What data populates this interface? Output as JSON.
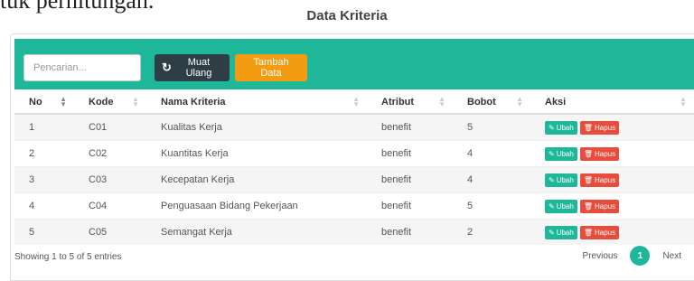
{
  "top_text": "tuk perhitungan.",
  "title": "Data Kriteria",
  "search": {
    "placeholder": "Pencarian..."
  },
  "buttons": {
    "reload": "Muat Ulang",
    "add": "Tambah Data"
  },
  "table": {
    "headers": [
      "No",
      "Kode",
      "Nama Kriteria",
      "Atribut",
      "Bobot",
      "Aksi"
    ],
    "rows": [
      [
        "1",
        "C01",
        "Kualitas Kerja",
        "benefit",
        "5"
      ],
      [
        "2",
        "C02",
        "Kuantitas Kerja",
        "benefit",
        "4"
      ],
      [
        "3",
        "C03",
        "Kecepatan Kerja",
        "benefit",
        "4"
      ],
      [
        "4",
        "C04",
        "Penguasaan Bidang Pekerjaan",
        "benefit",
        "5"
      ],
      [
        "5",
        "C05",
        "Semangat Kerja",
        "benefit",
        "2"
      ]
    ],
    "action_edit": "Ubah",
    "action_delete": "Hapus"
  },
  "footer": {
    "info": "Showing 1 to 5 of 5 entries",
    "previous": "Previous",
    "page": "1",
    "next": "Next"
  },
  "colors": {
    "accent": "#1fb79a",
    "reload": "#2f3e46",
    "add": "#f39c12",
    "delete": "#e74c3c"
  },
  "icons": {
    "reload": "refresh-icon",
    "edit": "edit-icon",
    "delete": "trash-icon"
  }
}
